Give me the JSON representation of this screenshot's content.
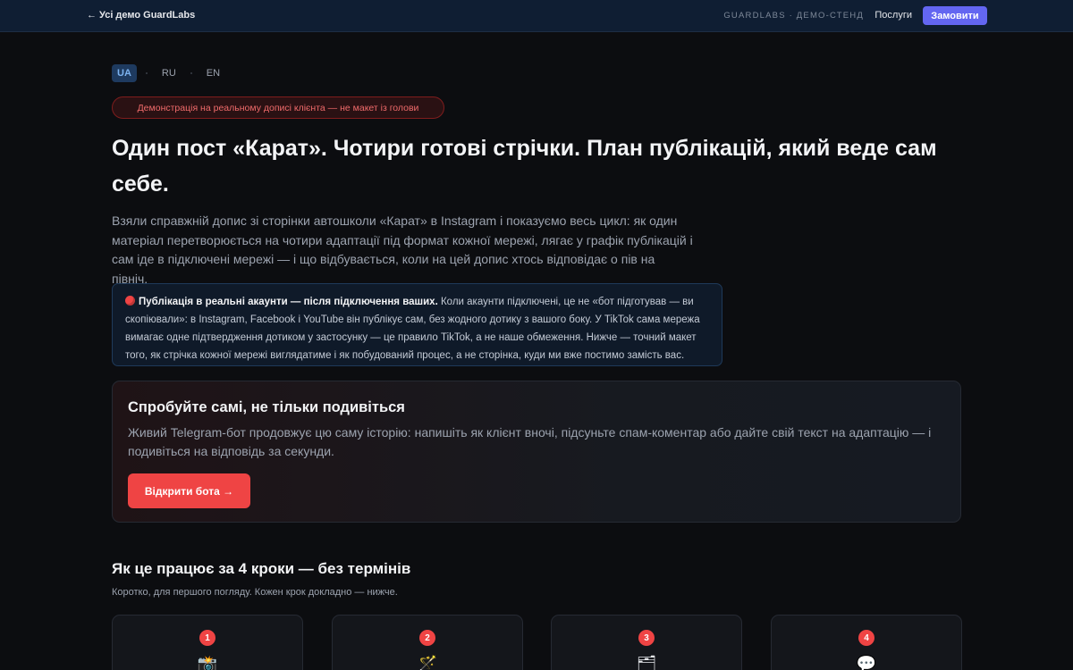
{
  "header": {
    "back_link": "← Усі демо GuardLabs",
    "brand_tag": "GUARDLABS · ДЕМО-СТЕНД",
    "services": "Послуги",
    "order": "Замовити"
  },
  "languages": [
    {
      "code": "UA",
      "active": true
    },
    {
      "code": "RU",
      "active": false
    },
    {
      "code": "EN",
      "active": false
    }
  ],
  "badge": "Демонстрація на реальному дописі клієнта — не макет із голови",
  "hero": {
    "title": "Один пост «Карат». Чотири готові стрічки. План публікацій, який веде сам себе.",
    "lead": "Взяли справжній допис зі сторінки автошколи «Карат» в Instagram і показуємо весь цикл: як один матеріал перетворюється на чотири адаптації під формат кожної мережі, лягає у графік публікацій і сам іде в підключені мережі — і що відбувається, коли на цей допис хтось відповідає о пів на північ."
  },
  "notice": {
    "lead": "Публікація в реальні акаунти — після підключення ваших.",
    "body": " Коли акаунти підключені, це не «бот підготував — ви скопіювали»: в Instagram, Facebook і YouTube він публікує сам, без жодного дотику з вашого боку. У TikTok сама мережа вимагає одне підтвердження дотиком у застосунку — це правило TikTok, а не наше обмеження. Нижче — точний макет того, як стрічка кожної мережі виглядатиме і як побудований процес, а не сторінка, куди ми вже постимо замість вас."
  },
  "try": {
    "title": "Спробуйте самі, не тільки подивіться",
    "desc": "Живий Telegram-бот продовжує цю саму історію: напишіть як клієнт вночі, підсуньте спам-коментар або дайте свій текст на адаптацію — і подивіться на відповідь за секунди.",
    "button": "Відкрити бота →"
  },
  "steps": {
    "title": "Як це працює за 4 кроки — без термінів",
    "subtitle": "Коротко, для першого погляду. Кожен крок докладно — нижче.",
    "items": [
      {
        "num": "1",
        "icon": "camera-flash-icon",
        "glyph": "📸"
      },
      {
        "num": "2",
        "icon": "magic-wand-icon",
        "glyph": "🪄"
      },
      {
        "num": "3",
        "icon": "card-index-icon",
        "glyph": "🗂"
      },
      {
        "num": "4",
        "icon": "speech-bubble-icon",
        "glyph": "💬"
      }
    ]
  },
  "colors": {
    "accent": "#ef4444",
    "primary": "#6366f1",
    "background": "#0c0d10"
  }
}
